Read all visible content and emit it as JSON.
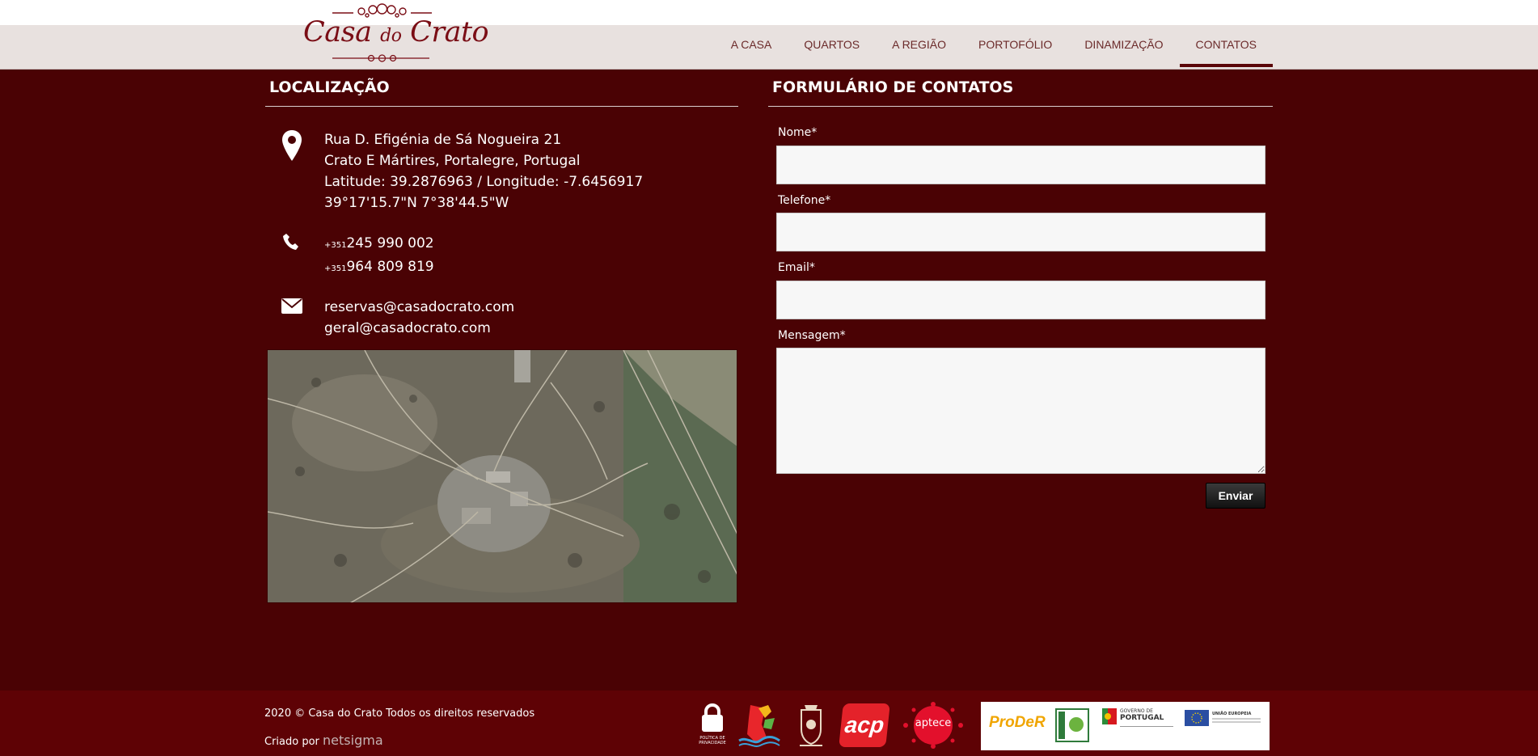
{
  "brand": {
    "name_part1": "Casa",
    "name_part2": "do",
    "name_part3": "Crato"
  },
  "nav": {
    "items": [
      "A CASA",
      "QUARTOS",
      "A REGIÃO",
      "PORTOFÓLIO",
      "DINAMIZAÇÃO",
      "CONTATOS"
    ],
    "active": "CONTATOS"
  },
  "location": {
    "title": "LOCALIZAÇÃO",
    "address": [
      "Rua D. Efigénia de Sá Nogueira 21",
      "Crato E Mártires, Portalegre, Portugal",
      "Latitude: 39.2876963 / Longitude: -7.6456917",
      "39°17'15.7\"N 7°38'44.5\"W"
    ],
    "phones": [
      {
        "prefix": "+351",
        "number": "245 990 002"
      },
      {
        "prefix": "+351",
        "number": "964 809 819"
      }
    ],
    "emails": [
      "reservas@casadocrato.com",
      "geral@casadocrato.com"
    ],
    "icons": [
      "map-pin-icon",
      "phone-icon",
      "envelope-icon"
    ]
  },
  "form": {
    "title": "FORMULÁRIO DE CONTATOS",
    "fields": [
      {
        "label": "Nome*",
        "value": ""
      },
      {
        "label": "Telefone*",
        "value": ""
      },
      {
        "label": "Email*",
        "value": ""
      },
      {
        "label": "Mensagem*",
        "value": ""
      }
    ],
    "submit_label": "Enviar"
  },
  "footer": {
    "copyright": "2020 © Casa do Crato Todos os direitos reservados",
    "credit_prefix": "Criado por",
    "credit_brand": "netsigma",
    "privacy_line1": "POLÍTICA DE",
    "privacy_line2": "PRIVACIDADE",
    "acp": "acp",
    "aptece": "aptece",
    "proder": "ProDeR",
    "governo_line1": "GOVERNO DE",
    "governo_line2": "PORTUGAL",
    "ue": "UNIÃO EUROPEIA"
  },
  "colors": {
    "background": "#4a0204",
    "footer": "#5e0205",
    "nav": "#e8e1df",
    "brand": "#7a0d15"
  }
}
